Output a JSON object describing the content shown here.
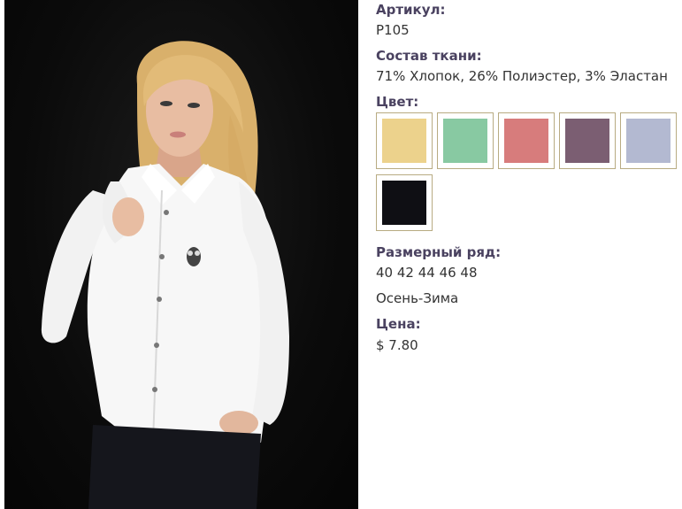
{
  "product": {
    "article_label": "Артикул:",
    "article_value": "P105",
    "fabric_label": "Состав ткани:",
    "fabric_value": "71% Хлопок, 26% Полиэстер, 3% Эластан",
    "color_label": "Цвет:",
    "colors": [
      {
        "name": "yellow",
        "hex": "#ecd28c"
      },
      {
        "name": "mint",
        "hex": "#88c9a2"
      },
      {
        "name": "coral",
        "hex": "#d77c7c"
      },
      {
        "name": "plum",
        "hex": "#7b5e72"
      },
      {
        "name": "lavender-grey",
        "hex": "#b3b9d1"
      },
      {
        "name": "black",
        "hex": "#0f0f14"
      }
    ],
    "size_label": "Размерный ряд:",
    "size_value": "40 42 44 46 48",
    "season_value": "Осень-Зима",
    "price_label": "Цена:",
    "price_value": "$ 7.80"
  }
}
